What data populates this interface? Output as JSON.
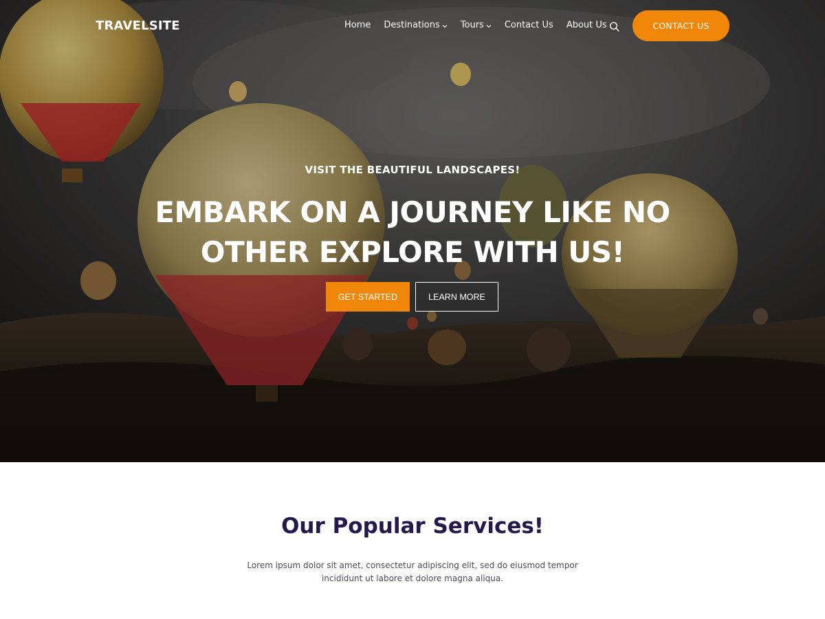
{
  "colors": {
    "accent": "#f0870a",
    "heading": "#25184a",
    "body_text": "#4b4b55",
    "white": "#ffffff"
  },
  "header": {
    "logo": "TRAVELSITE",
    "nav": [
      {
        "label": "Home"
      },
      {
        "label": "Destinations",
        "icon": "chevron-down-icon"
      },
      {
        "label": "Tours",
        "icon": "chevron-down-icon"
      },
      {
        "label": "Contact Us"
      },
      {
        "label": "About Us"
      }
    ],
    "search_icon": "search-icon",
    "cta_label": "CONTACT US"
  },
  "hero": {
    "subtitle": "VISIT THE BEAUTIFUL LANDSCAPES!",
    "title_line1": "EMBARK ON A JOURNEY LIKE NO",
    "title_line2": "OTHER EXPLORE WITH US!",
    "primary_button": "GET STARTED",
    "secondary_button": "LEARN MORE",
    "background": "hot-air-balloons-photo"
  },
  "services": {
    "title": "Our Popular Services!",
    "description_line1": "Lorem ipsum dolor sit amet, consectetur adipiscing elit, sed do eiusmod tempor",
    "description_line2": "incididunt ut labore et dolore magna aliqua."
  }
}
